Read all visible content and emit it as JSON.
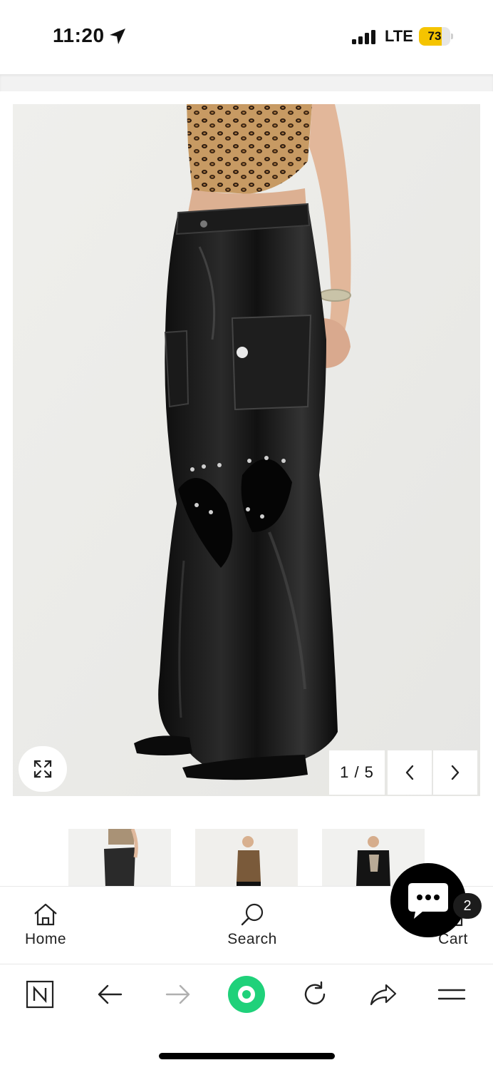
{
  "status_bar": {
    "time": "11:20",
    "network": "LTE",
    "battery_percent": "73",
    "battery_level": 0.73,
    "icons": [
      "location-arrow-icon",
      "signal-bars-icon",
      "battery-icon"
    ]
  },
  "gallery": {
    "counter": "1 / 5",
    "current": 1,
    "total": 5,
    "icons": [
      "expand-icon",
      "chevron-left-icon",
      "chevron-right-icon"
    ]
  },
  "thumbnails": {
    "count_visible": 3
  },
  "bottom_nav": {
    "home_label": "Home",
    "search_label": "Search",
    "cart_label": "Cart",
    "cart_count": "2"
  },
  "colors": {
    "battery_fill": "#f5c400",
    "browser_accent": "#1fd17a",
    "image_background": "#ededea"
  },
  "browser_toolbar": {
    "icons": [
      "tabs-n-icon",
      "back-arrow-icon",
      "forward-arrow-icon",
      "home-circle-icon",
      "reload-icon",
      "share-icon",
      "menu-icon"
    ]
  }
}
